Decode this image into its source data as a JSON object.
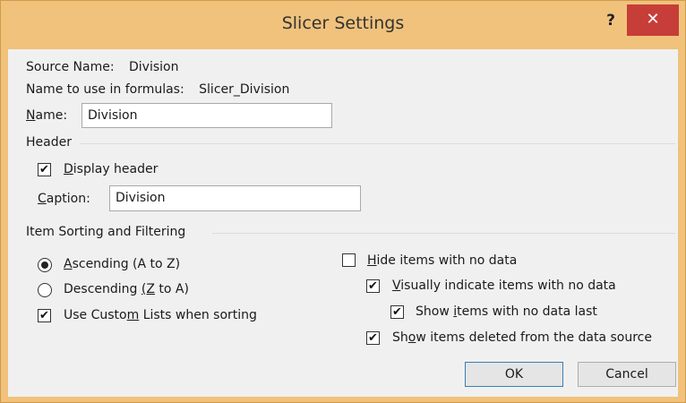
{
  "window": {
    "title": "Slicer Settings",
    "help_label": "?",
    "close_label": "✕"
  },
  "source": {
    "source_name_label": "Source Name:",
    "source_name_value": "Division",
    "formula_name_label": "Name to use in formulas:",
    "formula_name_value": "Slicer_Division",
    "name_label_mnemonic": "N",
    "name_label_rest": "ame:",
    "name_value": "Division"
  },
  "header": {
    "section_label": "Header",
    "display_header": {
      "mnemonic": "D",
      "rest": "isplay header",
      "checked": true
    },
    "caption_label_mnemonic": "C",
    "caption_label_rest": "aption:",
    "caption_value": "Division"
  },
  "sorting": {
    "section_label": "Item Sorting and Filtering",
    "ascending": {
      "mnemonic": "A",
      "rest": "scending (A to Z)",
      "selected": true
    },
    "descending": {
      "pre": "Descending ",
      "mnemonic": "(Z",
      "rest": " to A)",
      "selected": false
    },
    "custom_lists": {
      "pre": "Use Custo",
      "mnemonic": "m",
      "rest": " Lists when sorting",
      "checked": true
    },
    "hide_no_data": {
      "mnemonic": "H",
      "rest": "ide items with no data",
      "checked": false
    },
    "visually_indicate": {
      "mnemonic": "V",
      "rest": "isually indicate items with no data",
      "checked": true
    },
    "show_last": {
      "pre": "Show ",
      "mnemonic": "i",
      "rest": "tems with no data last",
      "checked": true
    },
    "show_deleted": {
      "pre": "Sh",
      "mnemonic": "o",
      "rest": "w items deleted from the data source",
      "checked": true
    }
  },
  "buttons": {
    "ok_label": "OK",
    "cancel_label": "Cancel"
  }
}
